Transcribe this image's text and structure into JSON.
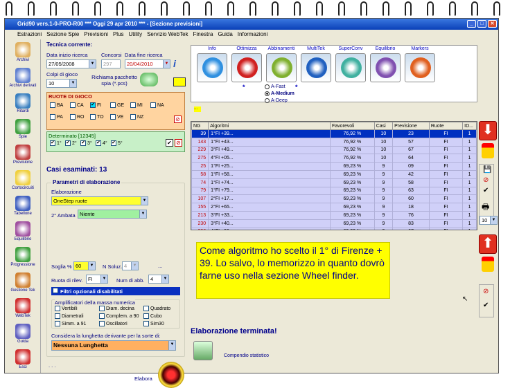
{
  "window": {
    "title": "Grid90 vers.1-0-PRO-R00  ***  Oggi 29 apr 2010  ***  - [Sezione previsioni]"
  },
  "menu": [
    "Estrazioni",
    "Sezione Spie",
    "Previsioni",
    "Plus",
    "Utility",
    "Servizio WebTek",
    "Finestra",
    "Guida",
    "Informazioni"
  ],
  "sidebar": [
    {
      "label": "Archivi",
      "color": "#e0b060"
    },
    {
      "label": "Archivi derivati",
      "color": "#6080d0"
    },
    {
      "label": "Ritardi",
      "color": "#3a80c0"
    },
    {
      "label": "Spie",
      "color": "#40a040"
    },
    {
      "label": "Previsione",
      "color": "#c04040"
    },
    {
      "label": "Cortocircuiti",
      "color": "#f0d040"
    },
    {
      "label": "Tabellone",
      "color": "#4060c0"
    },
    {
      "label": "Equilibrio",
      "color": "#a050a0"
    },
    {
      "label": "Progressione",
      "color": "#40a040"
    },
    {
      "label": "Gestione Tek",
      "color": "#d08030"
    },
    {
      "label": "WebTek",
      "color": "#d03030"
    },
    {
      "label": "Guida",
      "color": "#6060c0"
    },
    {
      "label": "Esci",
      "color": "#d03030"
    }
  ],
  "tecnica": {
    "heading": "Tecnica corrente:",
    "data_inizio_label": "Data inizio ricerca",
    "data_inizio": "27/05/2008",
    "concorsi_label": "Concorsi",
    "concorsi": "297",
    "data_fine_label": "Data fine ricerca",
    "data_fine": "20/04/2010",
    "colpi_label": "Colpi di gioco",
    "colpi": "10",
    "pacchetto_label": "Richiama pacchetto spia (*.pcs)"
  },
  "ruote": {
    "title": "RUOTE DI GIOCO",
    "row1": [
      "BA",
      "CA",
      "FI",
      "GE",
      "MI",
      "NA"
    ],
    "row2": [
      "PA",
      "RO",
      "TO",
      "VE",
      "NZ"
    ],
    "checked": "FI",
    "determinato_label": "Determinato [12345]",
    "determinato": [
      "1°",
      "2°",
      "3°",
      "4°",
      "5°"
    ]
  },
  "casi_esaminati": "Casi esaminati: 13",
  "parametri": {
    "title": "Parametri di elaborazione",
    "elaborazione_label": "Elaborazione",
    "elaborazione": "OneStep ruote",
    "ambata_label": "2° Ambata",
    "ambata": "Niente",
    "soglia_label": "Soglia %",
    "soglia": "60",
    "nsoluz_label": "N Soluz.",
    "nsoluz": "4",
    "ellipsis": "...",
    "ruota_rilev_label": "Ruota di rilev.",
    "ruota_rilev": "FI",
    "num_abb_label": "Num di abb.",
    "num_abb": "4",
    "filtri_label": "Filtri opzionali disabilitati",
    "amplificatori_title": "Amplificatori della massa numerica",
    "amplificatori": [
      "Vertibili",
      "Diam. decina",
      "Quadrato",
      "Diametrali",
      "Complem. a 90",
      "Cubo",
      "Simm. a 91",
      "Oscillatori",
      "Sim30"
    ],
    "lunghetta_label": "Considera la lunghetta derivante per la sorte di:",
    "lunghetta": "Nessuna Lunghetta",
    "dots": ". . .",
    "elabora_label": "Elabora"
  },
  "tools": [
    {
      "label": "Info",
      "color": "#3090e0"
    },
    {
      "label": "Ottimizza",
      "color": "#d02020"
    },
    {
      "label": "Abbinamenti",
      "color": "#80b030"
    },
    {
      "label": "MultiTek",
      "color": "#2060c0"
    },
    {
      "label": "SuperConv",
      "color": "#40b0a0"
    },
    {
      "label": "Equilibrio",
      "color": "#8050b0"
    },
    {
      "label": "Markers",
      "color": "#e06020"
    }
  ],
  "modes": [
    "A-Fast",
    "A-Medium",
    "A-Deep"
  ],
  "selected_mode": "A-Medium",
  "table": {
    "headers": [
      "NG",
      "Algoritmi",
      "Favorevoli",
      "Casi",
      "Previsione",
      "Ruote",
      "ID..."
    ],
    "rows": [
      [
        "39",
        "1°FI +39...",
        "76,92 %",
        "10",
        "23",
        "FI",
        "1"
      ],
      [
        "143",
        "1°FI +43...",
        "76,92 %",
        "10",
        "57",
        "FI",
        "1"
      ],
      [
        "229",
        "3°FI +49...",
        "76,92 %",
        "10",
        "67",
        "FI",
        "1"
      ],
      [
        "275",
        "4°FI +05...",
        "76,92 %",
        "10",
        "64",
        "FI",
        "1"
      ],
      [
        "25",
        "1°FI +25...",
        "69,23 %",
        "9",
        "09",
        "FI",
        "1"
      ],
      [
        "58",
        "1°FI +58...",
        "69,23 %",
        "9",
        "42",
        "FI",
        "1"
      ],
      [
        "74",
        "1°FI +74...",
        "69,23 %",
        "9",
        "58",
        "FI",
        "1"
      ],
      [
        "79",
        "1°FI +79...",
        "69,23 %",
        "9",
        "63",
        "FI",
        "1"
      ],
      [
        "107",
        "2°FI +17...",
        "69,23 %",
        "9",
        "60",
        "FI",
        "1"
      ],
      [
        "155",
        "2°FI +65...",
        "69,23 %",
        "9",
        "18",
        "FI",
        "1"
      ],
      [
        "213",
        "3°FI +33...",
        "69,23 %",
        "9",
        "76",
        "FI",
        "1"
      ],
      [
        "230",
        "3°FI +40...",
        "69,23 %",
        "9",
        "83",
        "FI",
        "1"
      ],
      [
        "296",
        "4°FI +26...",
        "69,23 %",
        "9",
        "67",
        "FI",
        "1"
      ]
    ]
  },
  "pages_value": "10",
  "note": "Come algoritmo ho scelto il 1° di Firenze + 39. Lo salvo, lo memorizzo in quanto dovrò farne uso nella sezione Wheel finder.",
  "status": "Elaborazione terminata!",
  "compendio_label": "Compendio statistico"
}
